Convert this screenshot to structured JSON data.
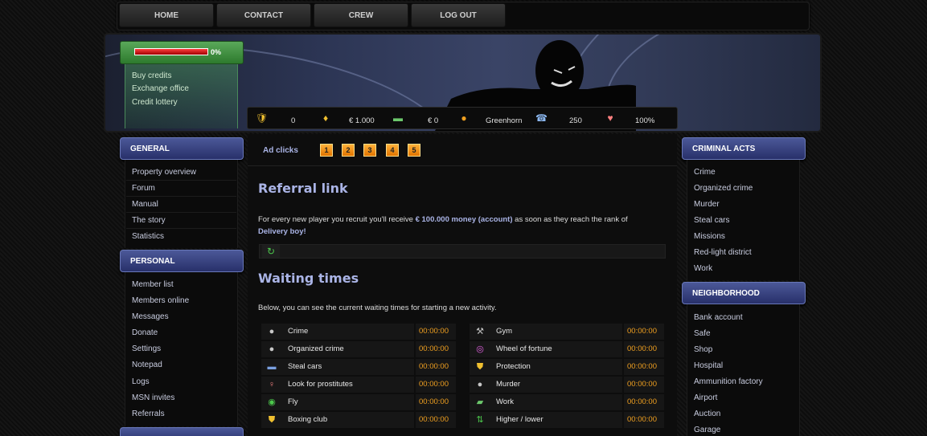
{
  "nav": [
    "HOME",
    "CONTACT",
    "CREW",
    "LOG OUT"
  ],
  "credits": {
    "progress_label": "0%",
    "progress_value": 0,
    "menu": [
      "Buy credits",
      "Exchange office",
      "Credit lottery"
    ]
  },
  "stats": {
    "shield": "0",
    "cash": "€ 1.000",
    "bank": "€ 0",
    "rank": "Greenhorn",
    "phone": "250",
    "health": "100%"
  },
  "left": {
    "general_title": "GENERAL",
    "general": [
      "Property overview",
      "Forum",
      "Manual",
      "The story",
      "Statistics"
    ],
    "personal_title": "PERSONAL",
    "personal": [
      "Member list",
      "Members online",
      "Messages",
      "Donate",
      "Settings",
      "Notepad",
      "Logs",
      "MSN invites",
      "Referrals"
    ]
  },
  "right": {
    "criminal_title": "CRIMINAL ACTS",
    "criminal": [
      "Crime",
      "Organized crime",
      "Murder",
      "Steal cars",
      "Missions",
      "Red-light district",
      "Work"
    ],
    "neighborhood_title": "NEIGHBORHOOD",
    "neighborhood": [
      "Bank account",
      "Safe",
      "Shop",
      "Hospital",
      "Ammunition factory",
      "Airport",
      "Auction",
      "Garage"
    ]
  },
  "main": {
    "ad_label": "Ad clicks",
    "ad_numbers": [
      "1",
      "2",
      "3",
      "4",
      "5"
    ],
    "referral_title": "Referral link",
    "referral_text_1": "For every new player you recruit you'll receive ",
    "referral_money": "€ 100.000 money (account)",
    "referral_text_2": " as soon as they reach the rank of",
    "referral_rank": "Delivery boy!",
    "waiting_title": "Waiting times",
    "waiting_intro": "Below, you can see the current waiting times for starting a new activity.",
    "left_times": [
      {
        "label": "Crime",
        "time": "00:00:00",
        "icon": "bomb-icon"
      },
      {
        "label": "Organized crime",
        "time": "00:00:00",
        "icon": "bomb-icon"
      },
      {
        "label": "Steal cars",
        "time": "00:00:00",
        "icon": "car-icon"
      },
      {
        "label": "Look for prostitutes",
        "time": "00:00:00",
        "icon": "woman-icon"
      },
      {
        "label": "Fly",
        "time": "00:00:00",
        "icon": "globe-icon"
      },
      {
        "label": "Boxing club",
        "time": "00:00:00",
        "icon": "shield-icon"
      }
    ],
    "right_times": [
      {
        "label": "Gym",
        "time": "00:00:00",
        "icon": "wrench-icon"
      },
      {
        "label": "Wheel of fortune",
        "time": "00:00:00",
        "icon": "wheel-icon"
      },
      {
        "label": "Protection",
        "time": "00:00:00",
        "icon": "shield-icon"
      },
      {
        "label": "Murder",
        "time": "00:00:00",
        "icon": "bomb-icon"
      },
      {
        "label": "Work",
        "time": "00:00:00",
        "icon": "money-icon"
      },
      {
        "label": "Higher / lower",
        "time": "00:00:00",
        "icon": "arrows-icon"
      }
    ]
  },
  "colors": {
    "accent": "#aab4e6",
    "time": "#f0a020",
    "panel": "#3a4688"
  }
}
